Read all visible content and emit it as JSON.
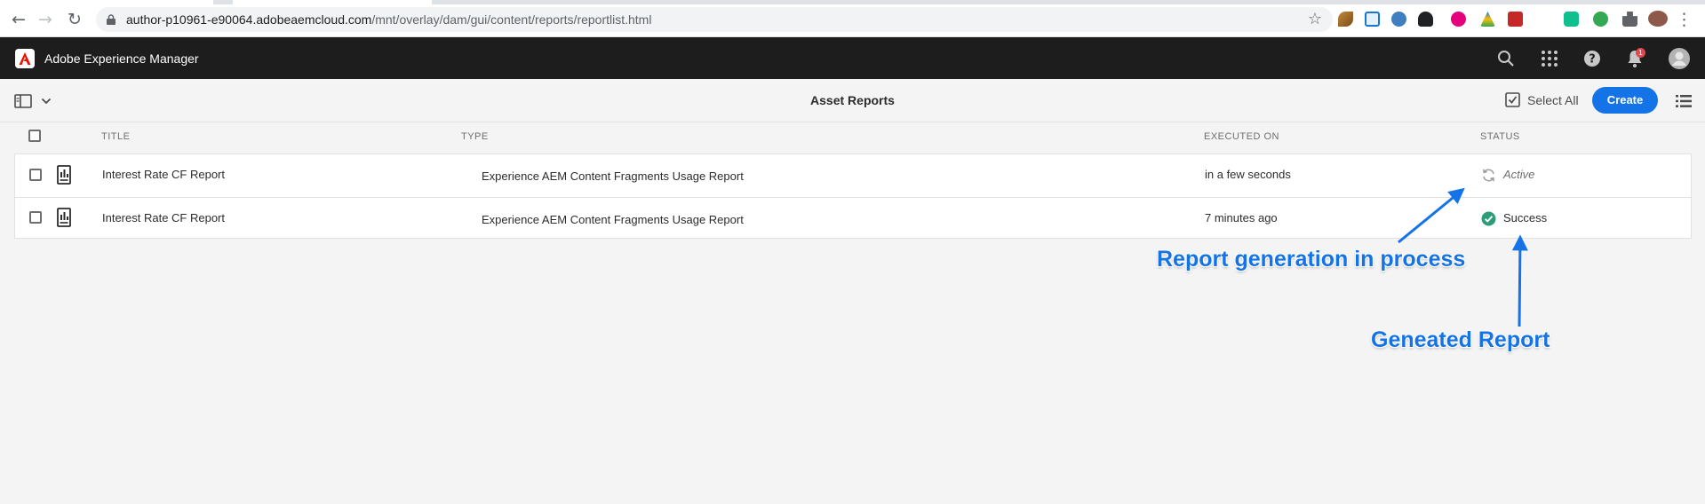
{
  "browser": {
    "url_host": "author-p10961-e90064.adobeaemcloud.com",
    "url_path": "/mnt/overlay/dam/gui/content/reports/reportlist.html"
  },
  "shell": {
    "app_title": "Adobe Experience Manager",
    "notification_count": "1"
  },
  "actionbar": {
    "page_title": "Asset Reports",
    "select_all_label": "Select All",
    "create_label": "Create"
  },
  "table": {
    "columns": [
      "TITLE",
      "TYPE",
      "EXECUTED ON",
      "STATUS"
    ],
    "rows": [
      {
        "title": "Interest Rate CF Report",
        "type": "Experience AEM Content Fragments Usage Report",
        "executed_on": "in a few seconds",
        "status": "Active"
      },
      {
        "title": "Interest Rate CF Report",
        "type": "Experience AEM Content Fragments Usage Report",
        "executed_on": "7 minutes ago",
        "status": "Success"
      }
    ]
  },
  "annotations": {
    "in_process": "Report generation in process",
    "generated": "Geneated Report"
  },
  "colors": {
    "accent": "#1473e6",
    "success": "#2d9d78",
    "shell_bg": "#1d1d1d",
    "adobe_red": "#eb1000"
  }
}
